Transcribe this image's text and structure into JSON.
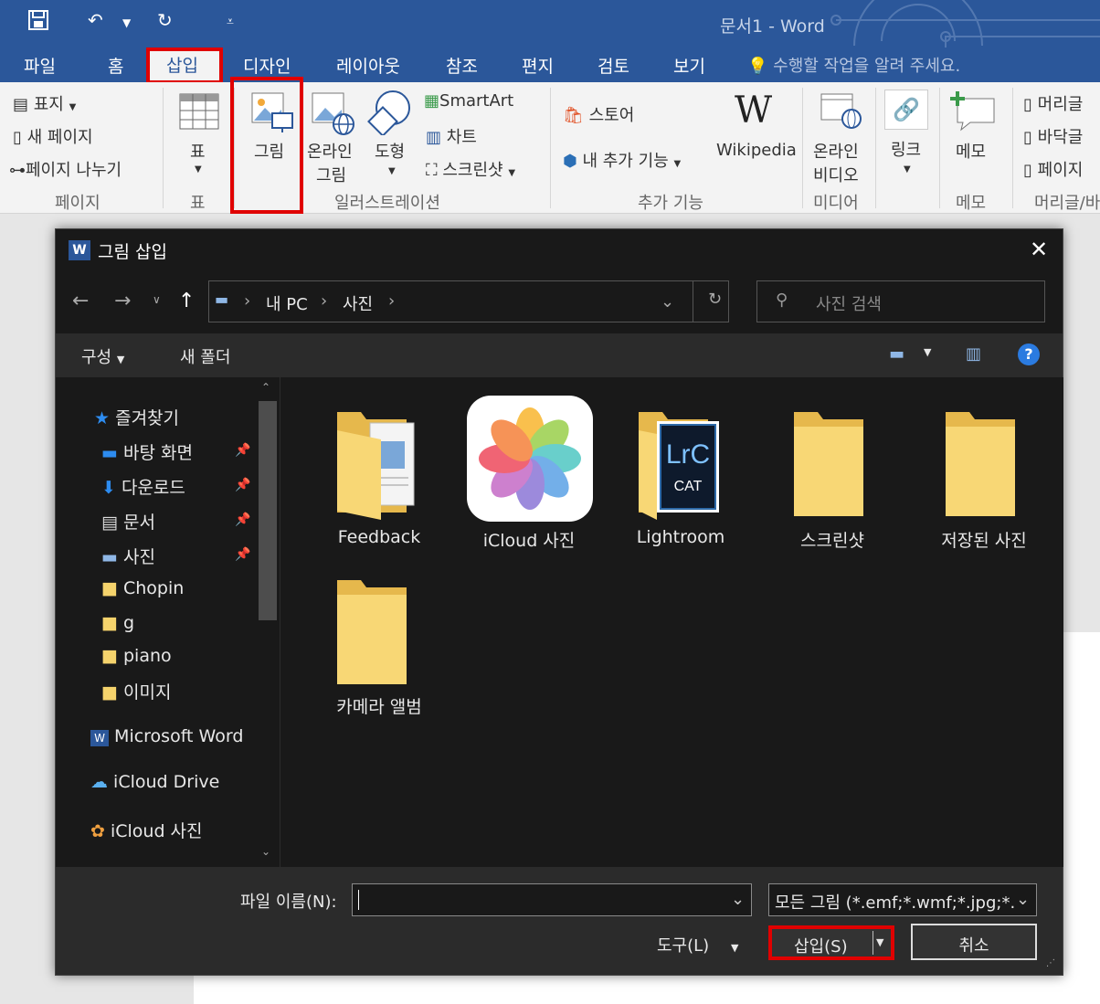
{
  "word": {
    "title": "문서1 - Word",
    "tabs": [
      "파일",
      "홈",
      "삽입",
      "디자인",
      "레이아웃",
      "참조",
      "편지",
      "검토",
      "보기"
    ],
    "active_tab": "삽입",
    "tell_me": "수행할 작업을 알려 주세요."
  },
  "ribbon": {
    "pages": {
      "cover": "표지",
      "blank": "새 페이지",
      "break": "페이지 나누기",
      "group": "페이지"
    },
    "table": {
      "label": "표",
      "group": "표"
    },
    "illustrations": {
      "picture": "그림",
      "online_picture_1": "온라인",
      "online_picture_2": "그림",
      "shapes": "도형",
      "smartart": "SmartArt",
      "chart": "차트",
      "screenshot": "스크린샷",
      "group": "일러스트레이션"
    },
    "addins": {
      "store": "스토어",
      "my_addins": "내 추가 기능",
      "wikipedia": "Wikipedia",
      "group": "추가 기능"
    },
    "media": {
      "video_1": "온라인",
      "video_2": "비디오",
      "group": "미디어"
    },
    "links": {
      "link": "링크"
    },
    "comments": {
      "comment": "메모",
      "group": "메모"
    },
    "header_footer": {
      "header": "머리글",
      "footer": "바닥글",
      "page_number": "페이지",
      "group": "머리글/바"
    }
  },
  "dialog": {
    "title": "그림 삽입",
    "breadcrumb": [
      "내 PC",
      "사진"
    ],
    "search_placeholder": "사진 검색",
    "organize": "구성",
    "new_folder": "새 폴더",
    "nav": {
      "favorites": "즐겨찾기",
      "items": [
        "바탕 화면",
        "다운로드",
        "문서",
        "사진",
        "Chopin",
        "g",
        "piano",
        "이미지"
      ],
      "word": "Microsoft Word",
      "icloud_drive": "iCloud Drive",
      "icloud_photos": "iCloud 사진"
    },
    "folders": [
      "Feedback",
      "iCloud 사진",
      "Lightroom",
      "스크린샷",
      "저장된 사진",
      "카메라 앨범"
    ],
    "file_name_label": "파일 이름(N):",
    "file_name_value": "",
    "file_type": "모든 그림 (*.emf;*.wmf;*.jpg;*.",
    "tools": "도구(L)",
    "insert": "삽입(S)",
    "cancel": "취소"
  },
  "colors": {
    "word_blue": "#2b579a",
    "highlight": "#e00000",
    "dialog_bg": "#191919"
  }
}
